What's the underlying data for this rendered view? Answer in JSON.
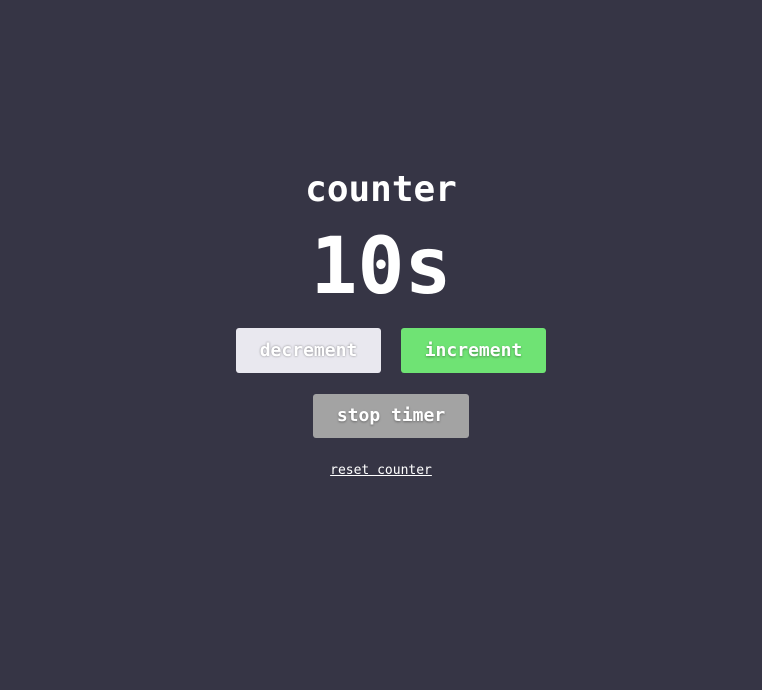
{
  "app": {
    "title": "counter",
    "count_display": "10s"
  },
  "controls": {
    "decrement_label": "decrement",
    "increment_label": "increment",
    "stop_label": "stop timer",
    "reset_label": "reset counter"
  },
  "colors": {
    "background": "#363545",
    "decrement_button": "#e9e8ef",
    "increment_button": "#6fe374",
    "stop_button": "#a3a3a3",
    "text": "#ffffff"
  }
}
